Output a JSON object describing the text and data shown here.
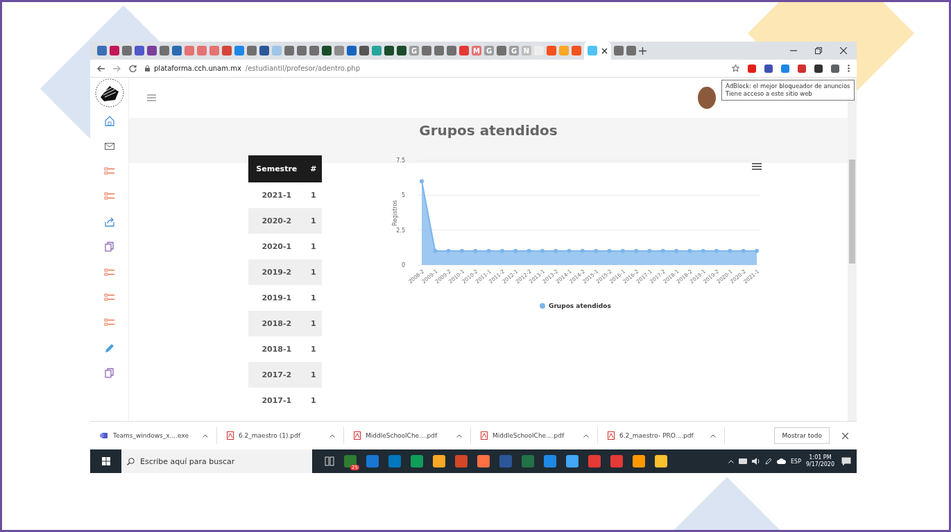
{
  "browser": {
    "tabs": [
      {
        "color": "#3b6fb6",
        "selected": false
      },
      {
        "color": "#c2185b",
        "selected": false
      },
      {
        "color": "#707070",
        "selected": false
      },
      {
        "color": "#5059c9",
        "selected": false
      },
      {
        "color": "#7b3f9e",
        "selected": false
      },
      {
        "color": "#707070",
        "selected": false
      },
      {
        "color": "#2b6cb0",
        "selected": false
      },
      {
        "color": "#e57373",
        "selected": false
      },
      {
        "color": "#e57373",
        "selected": false
      },
      {
        "color": "#e57373",
        "selected": false
      },
      {
        "color": "#d44638",
        "selected": false
      },
      {
        "color": "#1e88e5",
        "selected": false
      },
      {
        "color": "#707070",
        "selected": false
      },
      {
        "color": "#2b579a",
        "selected": false
      },
      {
        "color": "#9ec5e8",
        "selected": false
      },
      {
        "color": "#707070",
        "selected": false
      },
      {
        "color": "#707070",
        "selected": false
      },
      {
        "color": "#707070",
        "selected": false
      },
      {
        "color": "#1b4d2b",
        "selected": false
      },
      {
        "color": "#8d8d8d",
        "selected": false
      },
      {
        "color": "#1565c0",
        "selected": false
      },
      {
        "color": "#555555",
        "selected": false
      },
      {
        "color": "#26a69a",
        "selected": false
      },
      {
        "color": "#1b4d2b",
        "selected": false
      },
      {
        "color": "#1b4d2b",
        "selected": false
      },
      {
        "color": "#9e9e9e",
        "selected": false,
        "glyph": "G"
      },
      {
        "color": "#707070",
        "selected": false
      },
      {
        "color": "#707070",
        "selected": false
      },
      {
        "color": "#707070",
        "selected": false
      },
      {
        "color": "#e53935",
        "selected": false
      },
      {
        "color": "#e57373",
        "selected": false,
        "glyph": "M"
      },
      {
        "color": "#9e9e9e",
        "selected": false,
        "glyph": "G"
      },
      {
        "color": "#707070",
        "selected": false
      },
      {
        "color": "#9e9e9e",
        "selected": false,
        "glyph": "G"
      },
      {
        "color": "#bdbdbd",
        "selected": false,
        "glyph": "N"
      },
      {
        "color": "#eeeeee",
        "selected": false
      },
      {
        "color": "#f4511e",
        "selected": false
      },
      {
        "color": "#f9a825",
        "selected": false
      },
      {
        "color": "#f4511e",
        "selected": false
      },
      {
        "color": "#4fc3f7",
        "selected": true
      },
      {
        "color": "#707070",
        "selected": false
      },
      {
        "color": "#707070",
        "selected": false
      }
    ],
    "url": {
      "host": "plataforma.cch.unam.mx",
      "path": "/estudiantil/profesor/adentro.php"
    },
    "extensions": [
      {
        "color": "#e0201b"
      },
      {
        "color": "#3f51b5"
      },
      {
        "color": "#1e88e5"
      },
      {
        "color": "#d32f2f"
      },
      {
        "color": "#333333"
      },
      {
        "color": "#5f6368"
      }
    ],
    "tooltip": [
      "AdBlock: el mejor bloqueador de anuncios",
      "Tiene acceso a este sitio web"
    ]
  },
  "sidebar": {
    "items": [
      {
        "kind": "home"
      },
      {
        "kind": "mail"
      },
      {
        "kind": "list"
      },
      {
        "kind": "list"
      },
      {
        "kind": "share"
      },
      {
        "kind": "copy"
      },
      {
        "kind": "list"
      },
      {
        "kind": "list"
      },
      {
        "kind": "list"
      },
      {
        "kind": "pencil"
      },
      {
        "kind": "copy"
      }
    ]
  },
  "page": {
    "title": "Grupos atendidos",
    "table": {
      "columns": [
        "Semestre",
        "#"
      ],
      "rows": [
        [
          "2021-1",
          "1"
        ],
        [
          "2020-2",
          "1"
        ],
        [
          "2020-1",
          "1"
        ],
        [
          "2019-2",
          "1"
        ],
        [
          "2019-1",
          "1"
        ],
        [
          "2018-2",
          "1"
        ],
        [
          "2018-1",
          "1"
        ],
        [
          "2017-2",
          "1"
        ],
        [
          "2017-1",
          "1"
        ]
      ]
    },
    "chart_data": {
      "type": "area",
      "ylabel": "Registros",
      "categories": [
        "2008-2",
        "2009-1",
        "2009-2",
        "2010-1",
        "2010-2",
        "2011-1",
        "2011-2",
        "2012-1",
        "2012-2",
        "2013-1",
        "2013-2",
        "2014-1",
        "2014-2",
        "2015-1",
        "2015-2",
        "2016-1",
        "2016-2",
        "2017-1",
        "2017-2",
        "2018-1",
        "2018-2",
        "2019-1",
        "2019-2",
        "2020-1",
        "2020-2",
        "2021-1"
      ],
      "series": [
        {
          "name": "Grupos atendidos",
          "color": "#7cb5ec",
          "values": [
            6,
            1,
            1,
            1,
            1,
            1,
            1,
            1,
            1,
            1,
            1,
            1,
            1,
            1,
            1,
            1,
            1,
            1,
            1,
            1,
            1,
            1,
            1,
            1,
            1,
            1
          ]
        }
      ],
      "ylim": [
        0,
        7.5
      ],
      "yticks": [
        0,
        {
          "value": 2.5,
          "label": "2.5"
        },
        5,
        {
          "value": 7.5,
          "label": "7.5"
        }
      ]
    }
  },
  "downloads": {
    "items": [
      {
        "kind": "exe",
        "name": "Teams_windows_x....exe"
      },
      {
        "kind": "pdf",
        "name": "6.2_maestro (1).pdf"
      },
      {
        "kind": "pdf",
        "name": "MiddleSchoolChe....pdf"
      },
      {
        "kind": "pdf",
        "name": "MiddleSchoolChe....pdf"
      },
      {
        "kind": "pdf",
        "name": "6.2_maestro- PRO....pdf"
      }
    ],
    "show_all": "Mostrar todo"
  },
  "taskbar": {
    "search_placeholder": "Escribe aquí para buscar",
    "apps": [
      {
        "color": "#2e7d32",
        "badge": "25"
      },
      {
        "color": "#1976d2"
      },
      {
        "color": "#0277bd"
      },
      {
        "color": "#0f9d58"
      },
      {
        "color": "#f9a825"
      },
      {
        "color": "#d24726"
      },
      {
        "color": "#ff7043"
      },
      {
        "color": "#2b579a"
      },
      {
        "color": "#217346"
      },
      {
        "color": "#1e88e5"
      },
      {
        "color": "#42a5f5"
      },
      {
        "color": "#e53935"
      },
      {
        "color": "#e53935"
      },
      {
        "color": "#ff9800"
      },
      {
        "color": "#fbc02d"
      }
    ],
    "language": "ESP",
    "time": "1:01 PM",
    "date": "9/17/2020"
  }
}
